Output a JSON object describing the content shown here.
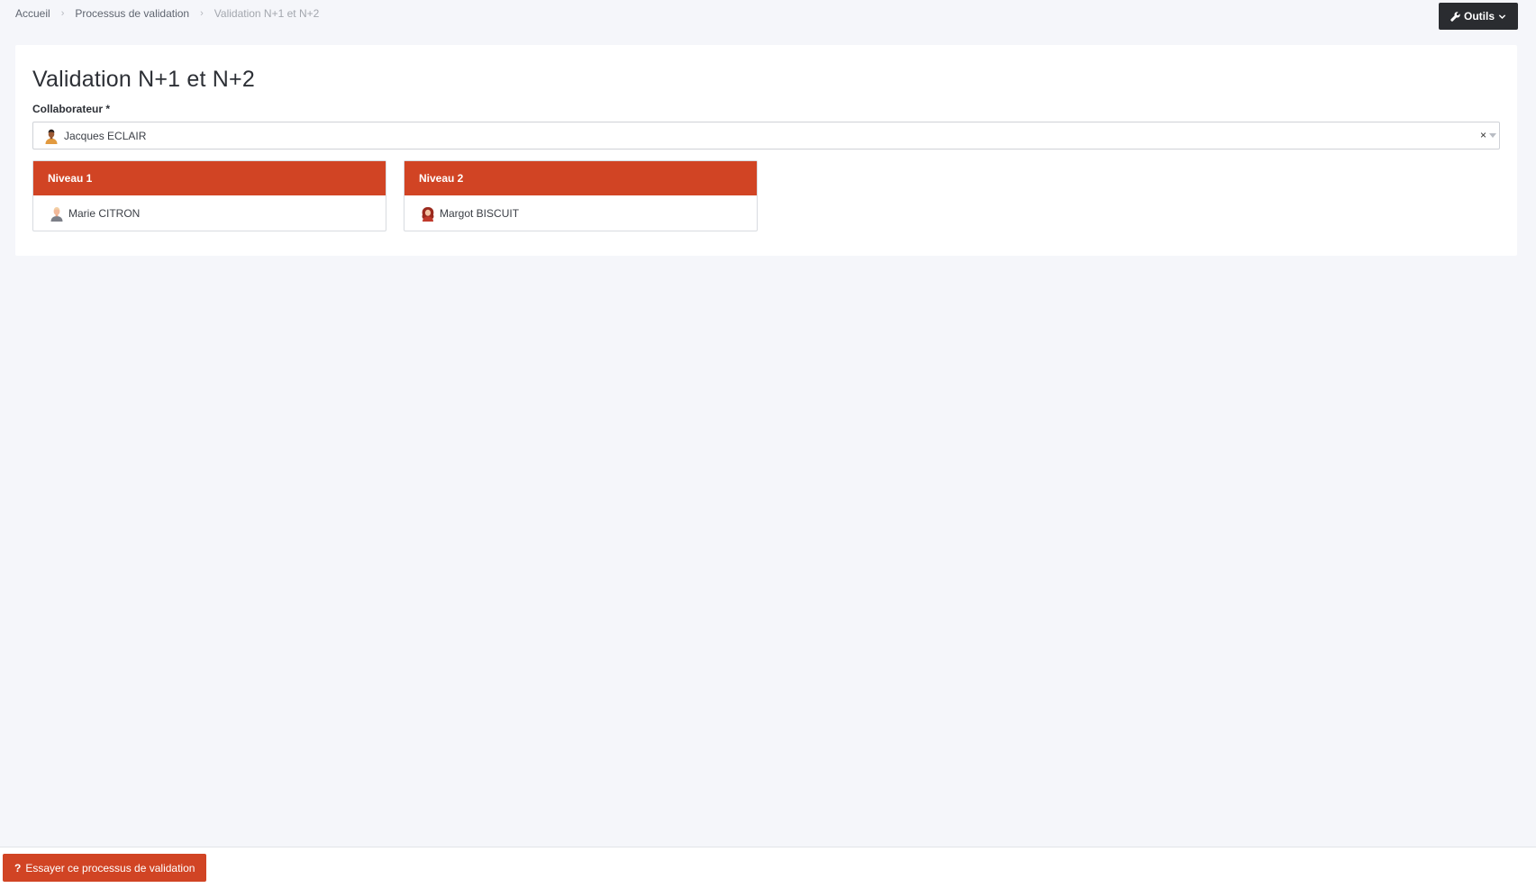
{
  "breadcrumb": {
    "items": [
      "Accueil",
      "Processus de validation",
      "Validation N+1 et N+2"
    ],
    "separator": "›"
  },
  "toolbar": {
    "tools_label": "Outils",
    "tools_icon": "wrench-icon"
  },
  "page": {
    "title": "Validation N+1 et N+2"
  },
  "form": {
    "collaborator_label": "Collaborateur *",
    "collaborator_value": "Jacques ECLAIR",
    "clear_symbol": "×"
  },
  "levels": [
    {
      "title": "Niveau 1",
      "person": "Marie CITRON"
    },
    {
      "title": "Niveau 2",
      "person": "Margot BISCUIT"
    }
  ],
  "footer": {
    "try_icon": "?",
    "try_label": "Essayer ce processus de validation"
  },
  "colors": {
    "accent": "#d14424",
    "dark_button": "#2a2c30",
    "background": "#f5f6fa"
  }
}
